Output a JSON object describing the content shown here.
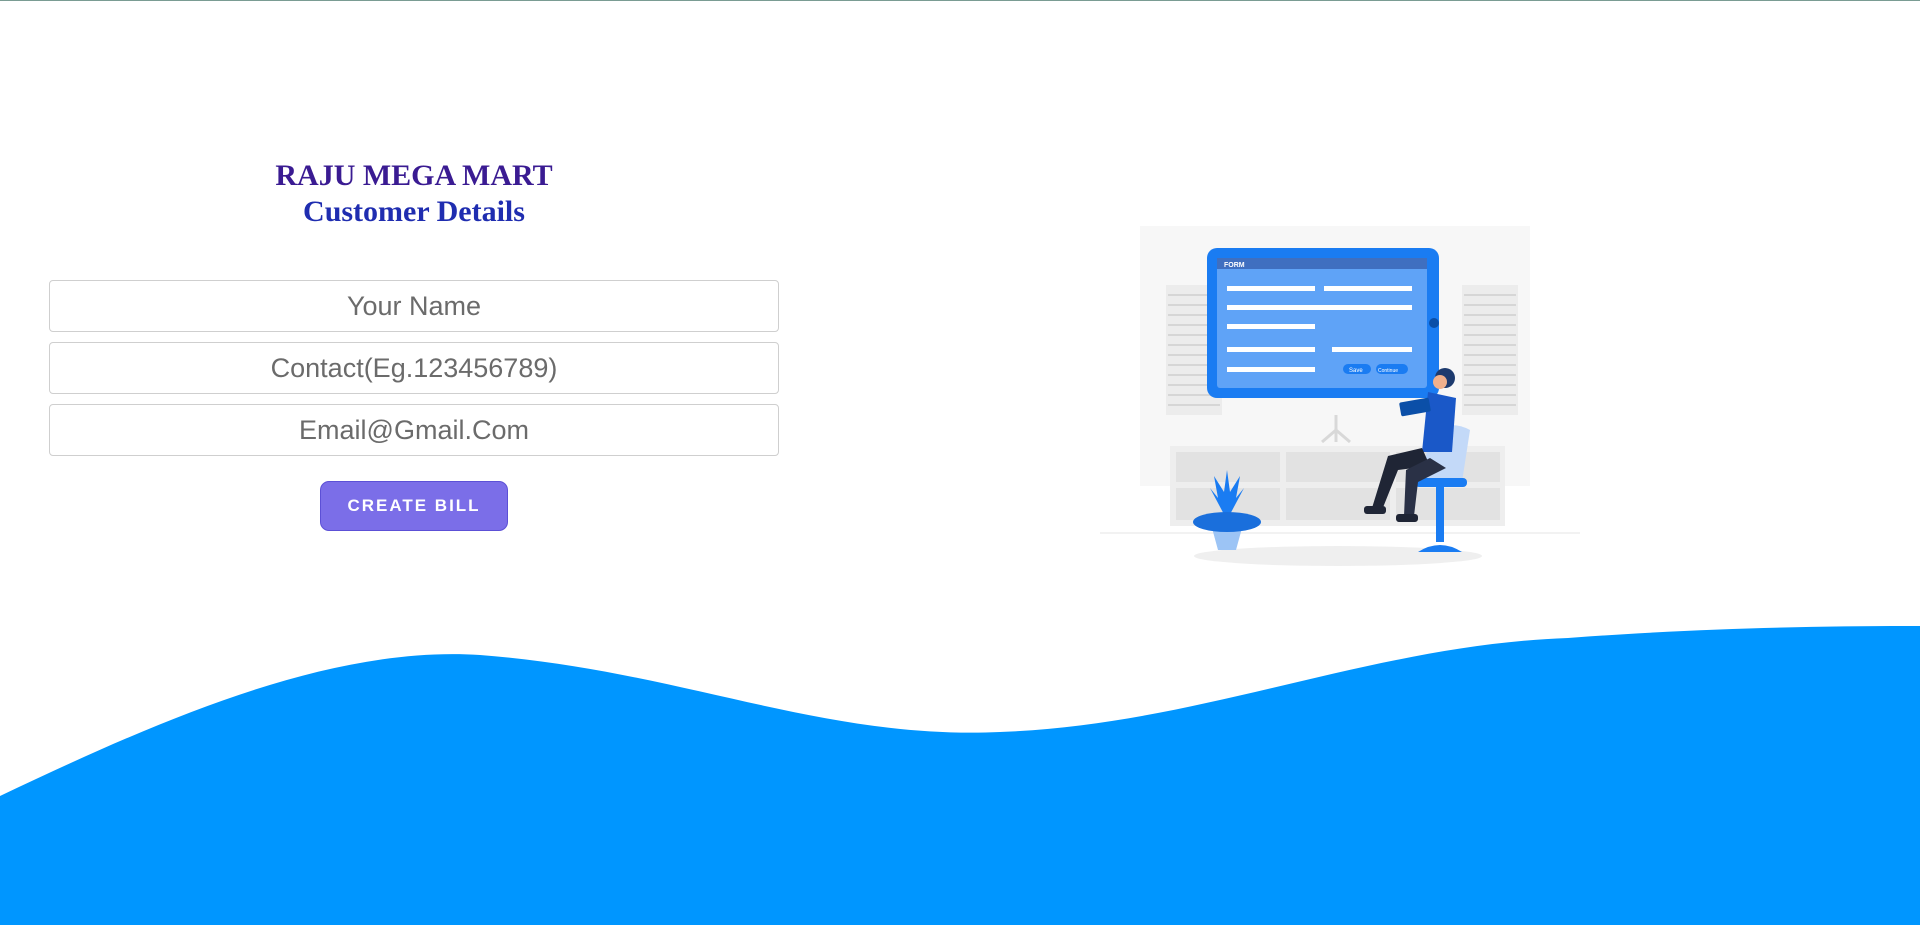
{
  "header": {
    "store_name": "RAJU MEGA MART",
    "section_title": "Customer Details"
  },
  "form": {
    "name_placeholder": "Your Name",
    "contact_placeholder": "Contact(Eg.123456789)",
    "email_placeholder": "Email@Gmail.Com",
    "submit_label": "CREATE BILL"
  },
  "illustration": {
    "form_title": "FORM",
    "save_label": "Save",
    "continue_label": "Continue"
  },
  "colors": {
    "wave": "#0096ff",
    "button": "#7b6ee8",
    "title": "#3a1b92",
    "subtitle": "#1f2db0"
  }
}
